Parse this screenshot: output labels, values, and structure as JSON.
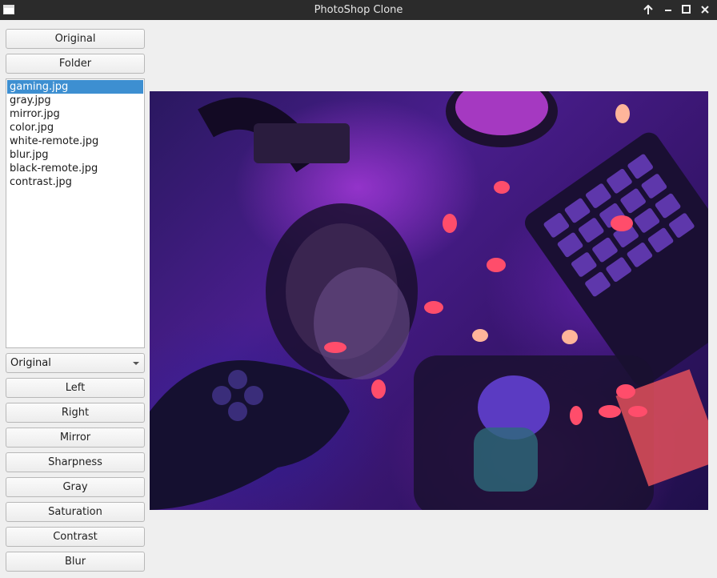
{
  "window": {
    "title": "PhotoShop Clone"
  },
  "buttons": {
    "original": "Original",
    "folder": "Folder",
    "left": "Left",
    "right": "Right",
    "mirror": "Mirror",
    "sharpness": "Sharpness",
    "gray": "Gray",
    "saturation": "Saturation",
    "contrast": "Contrast",
    "blur": "Blur"
  },
  "files": [
    "gaming.jpg",
    "gray.jpg",
    "mirror.jpg",
    "color.jpg",
    "white-remote.jpg",
    "blur.jpg",
    "black-remote.jpg",
    "contrast.jpg"
  ],
  "selected_file_index": 0,
  "filter_combo": {
    "selected": "Original"
  },
  "colors": {
    "selection": "#3d8fd1",
    "titlebar": "#2b2b2b",
    "background": "#efefef"
  },
  "image": {
    "description_icon": "photo-image"
  }
}
